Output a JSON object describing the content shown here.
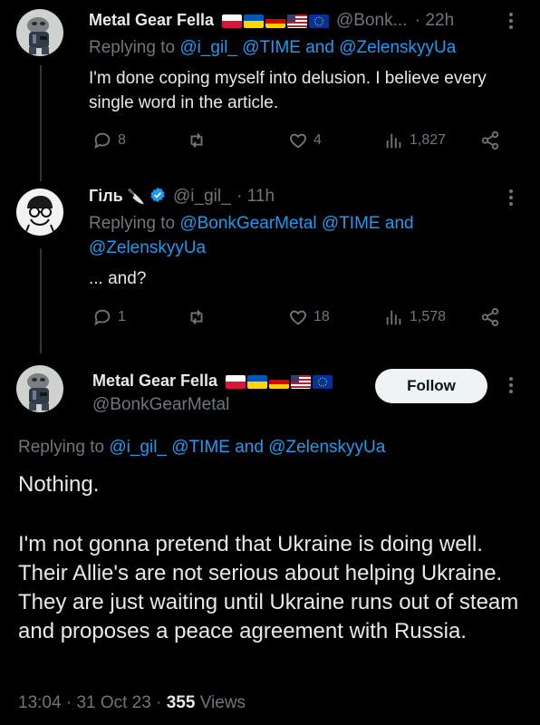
{
  "tweet1": {
    "name": "Metal Gear Fella",
    "handle": "@Bonk...",
    "time": "· 22h",
    "replying_prefix": "Replying to",
    "replying_users": "@i_gil_ @TIME",
    "replying_and": "and",
    "replying_last": "@ZelenskyyUa",
    "text": "I'm done coping myself into delusion. I believe every single word in the article.",
    "replies": "8",
    "retweets": "",
    "likes": "4",
    "views": "1,827"
  },
  "tweet2": {
    "name": "Гіль",
    "emoji": "🔪",
    "handle": "@i_gil_",
    "time": "· 11h",
    "replying_prefix": "Replying to",
    "replying_users": "@BonkGearMetal @TIME",
    "replying_and": "and",
    "replying_last": "@ZelenskyyUa",
    "text": "... and?",
    "replies": "1",
    "retweets": "",
    "likes": "18",
    "views": "1,578"
  },
  "main": {
    "name": "Metal Gear Fella",
    "handle": "@BonkGearMetal",
    "follow_label": "Follow",
    "replying_prefix": "Replying to",
    "replying_users": "@i_gil_ @TIME",
    "replying_and": "and",
    "replying_last": "@ZelenskyyUa",
    "text_p1": "Nothing.",
    "text_p2": "I'm not gonna pretend that Ukraine is doing well. Their Allie's are not serious about helping Ukraine. They are just waiting until Ukraine runs out of steam and proposes a peace agreement with Russia.",
    "time": "13:04",
    "date": "31 Oct 23",
    "views_count": "355",
    "views_label": "Views"
  },
  "colors": {
    "accent": "#1d9bf0",
    "muted": "#71767b",
    "text": "#e7e9ea",
    "background": "#000000"
  }
}
